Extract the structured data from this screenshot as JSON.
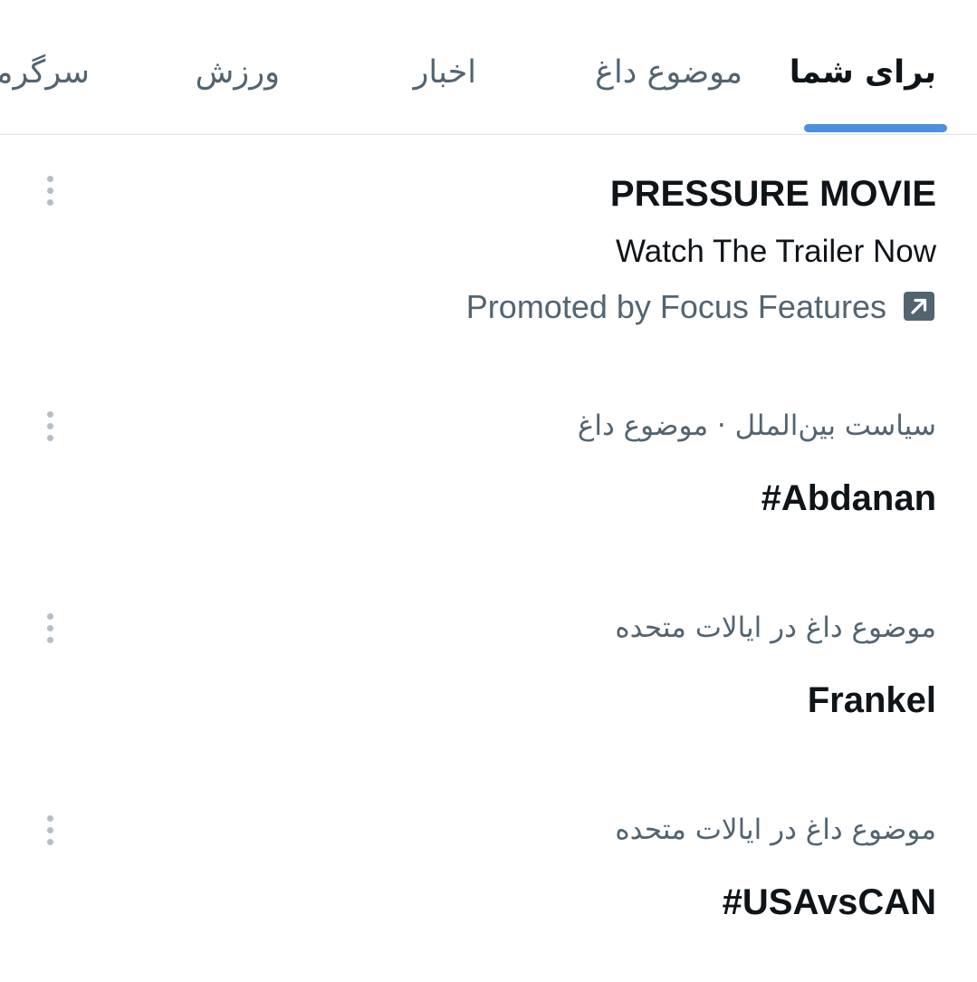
{
  "tabs": [
    {
      "label": "برای شما",
      "active": true
    },
    {
      "label": "موضوع داغ",
      "active": false
    },
    {
      "label": "اخبار",
      "active": false
    },
    {
      "label": "ورزش",
      "active": false
    },
    {
      "label": "سرگرمی",
      "active": false
    }
  ],
  "accent_color": "#4a90e2",
  "promoted": {
    "title": "PRESSURE MOVIE",
    "subtitle": "Watch The Trailer Now",
    "promoted_by": "Promoted by Focus Features",
    "icon": "external-link-icon"
  },
  "trends": [
    {
      "context": "سیاست بین‌الملل · موضوع داغ",
      "name": "#Abdanan"
    },
    {
      "context": "موضوع داغ در ایالات متحده",
      "name": "Frankel"
    },
    {
      "context": "موضوع داغ در ایالات متحده",
      "name": "#USAvsCAN"
    }
  ],
  "more_icon": "more-vertical-icon"
}
